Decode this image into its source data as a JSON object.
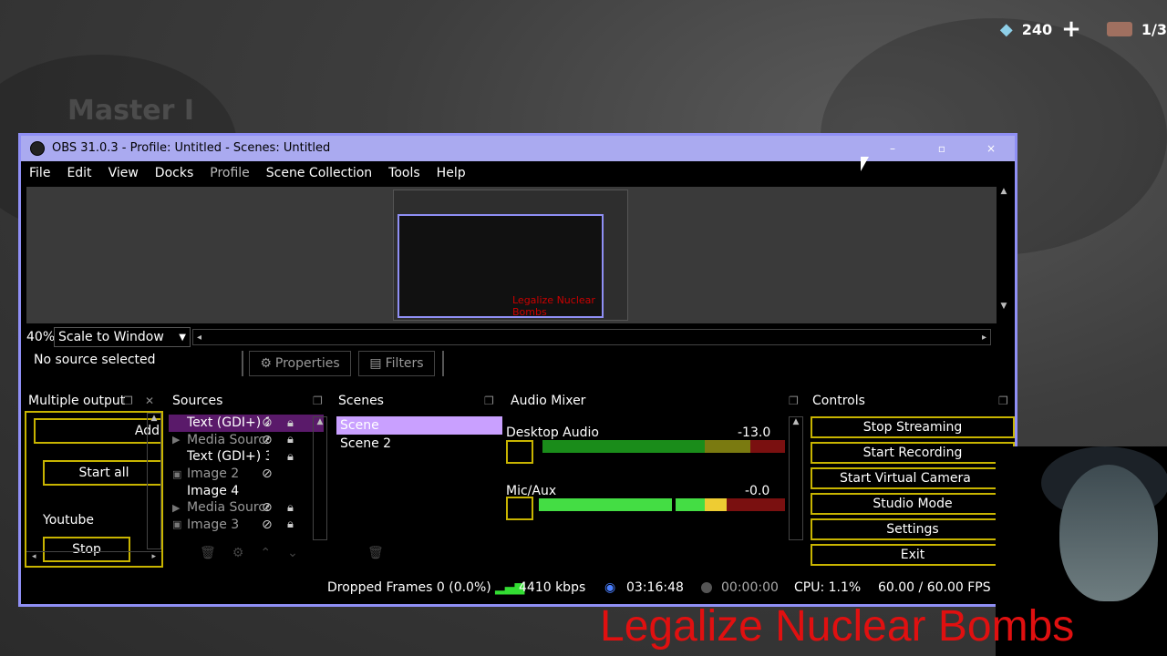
{
  "hud": {
    "count": "240",
    "page": "1/3"
  },
  "background": {
    "title": "Master I"
  },
  "window": {
    "title": "OBS 31.0.3 - Profile: Untitled - Scenes: Untitled",
    "minimize": "–",
    "maximize": "▫",
    "close": "×"
  },
  "menu": [
    "File",
    "Edit",
    "View",
    "Docks",
    "Profile",
    "Scene Collection",
    "Tools",
    "Help"
  ],
  "preview": {
    "caption": "Legalize Nuclear Bombs"
  },
  "scale": {
    "percent": "40%",
    "mode": "Scale to Window"
  },
  "source_toolbar": {
    "no_source": "No source selected",
    "properties": "Properties",
    "filters": "Filters"
  },
  "docks": {
    "multiple_output": "Multiple output",
    "sources": "Sources",
    "scenes": "Scenes",
    "audio_mixer": "Audio Mixer",
    "controls": "Controls"
  },
  "multiple_output": {
    "add": "Add",
    "start_all": "Start all",
    "youtube": "Youtube",
    "stop": "Stop"
  },
  "sources": [
    {
      "name": "Text (GDI+) 2",
      "visible": false,
      "dim": true,
      "selected": true
    },
    {
      "name": "Media Source",
      "visible": false,
      "dim": true,
      "selected": false
    },
    {
      "name": "Text (GDI+) 3",
      "visible": true,
      "dim": false,
      "selected": false
    },
    {
      "name": "Image 2",
      "visible": false,
      "dim": true,
      "selected": false
    },
    {
      "name": "Image 4",
      "visible": true,
      "dim": false,
      "selected": false
    },
    {
      "name": "Media Source",
      "visible": false,
      "dim": true,
      "selected": false
    },
    {
      "name": "Image 3",
      "visible": false,
      "dim": true,
      "selected": false
    }
  ],
  "scenes": [
    {
      "name": "Scene",
      "selected": true
    },
    {
      "name": "Scene 2",
      "selected": false
    }
  ],
  "mixer": [
    {
      "name": "Desktop Audio",
      "db": "-13.0 dB"
    },
    {
      "name": "Mic/Aux",
      "db": "-0.0 dB"
    }
  ],
  "controls": [
    "Stop Streaming",
    "Start Recording",
    "Start Virtual Camera",
    "Studio Mode",
    "Settings",
    "Exit"
  ],
  "status": {
    "dropped": "Dropped Frames 0 (0.0%)",
    "bitrate": "4410 kbps",
    "stream_time": "03:16:48",
    "rec_time": "00:00:00",
    "cpu": "CPU: 1.1%",
    "fps": "60.00 / 60.00 FPS"
  },
  "overlay": {
    "caption": "Legalize Nuclear Bombs"
  },
  "colors": {
    "title_bar": "#aaaaf0",
    "window_border": "#8f8ff5",
    "accent_yellow": "#c8b400",
    "scene_selected": "#c9a0ff",
    "caption_red": "#e01010"
  }
}
